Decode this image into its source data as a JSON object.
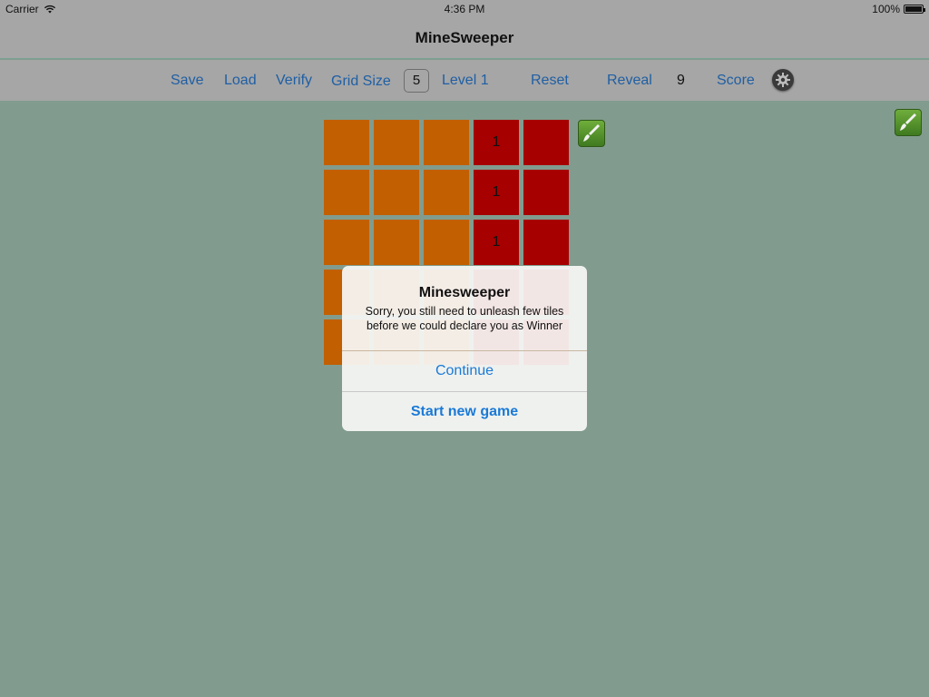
{
  "status_bar": {
    "carrier": "Carrier",
    "time": "4:36 PM",
    "battery": "100%"
  },
  "nav": {
    "title": "MineSweeper"
  },
  "toolbar": {
    "save": "Save",
    "load": "Load",
    "verify": "Verify",
    "grid_size_label": "Grid Size",
    "grid_size_value": "5",
    "level": "Level 1",
    "reset": "Reset",
    "reveal": "Reveal",
    "reveal_count": "9",
    "score": "Score"
  },
  "board": {
    "rows": 5,
    "cols": 5,
    "colors": {
      "covered": "#c25f00",
      "revealed": "#a60000"
    },
    "cells": [
      [
        "covered",
        "covered",
        "covered",
        "revealed",
        "revealed"
      ],
      [
        "covered",
        "covered",
        "covered",
        "revealed",
        "revealed"
      ],
      [
        "covered",
        "covered",
        "covered",
        "revealed",
        "revealed"
      ],
      [
        "covered",
        "covered",
        "covered",
        "revealed",
        "revealed"
      ],
      [
        "covered",
        "covered",
        "covered",
        "revealed",
        "revealed"
      ]
    ],
    "labels": [
      [
        "",
        "",
        "",
        "1",
        ""
      ],
      [
        "",
        "",
        "",
        "1",
        ""
      ],
      [
        "",
        "",
        "",
        "1",
        ""
      ],
      [
        "",
        "",
        "",
        "",
        ""
      ],
      [
        "",
        "",
        "",
        "",
        ""
      ]
    ]
  },
  "alert": {
    "title": "Minesweeper",
    "message_line1": "Sorry, you still need to unleash few tiles",
    "message_line2": "before we could declare you as Winner",
    "continue": "Continue",
    "new_game": "Start new game"
  },
  "colors": {
    "background": "#819c8e",
    "bars": "#a6a6a6",
    "toolbar_link": "#1f5fa4",
    "alert_button": "#1a7ad6"
  }
}
